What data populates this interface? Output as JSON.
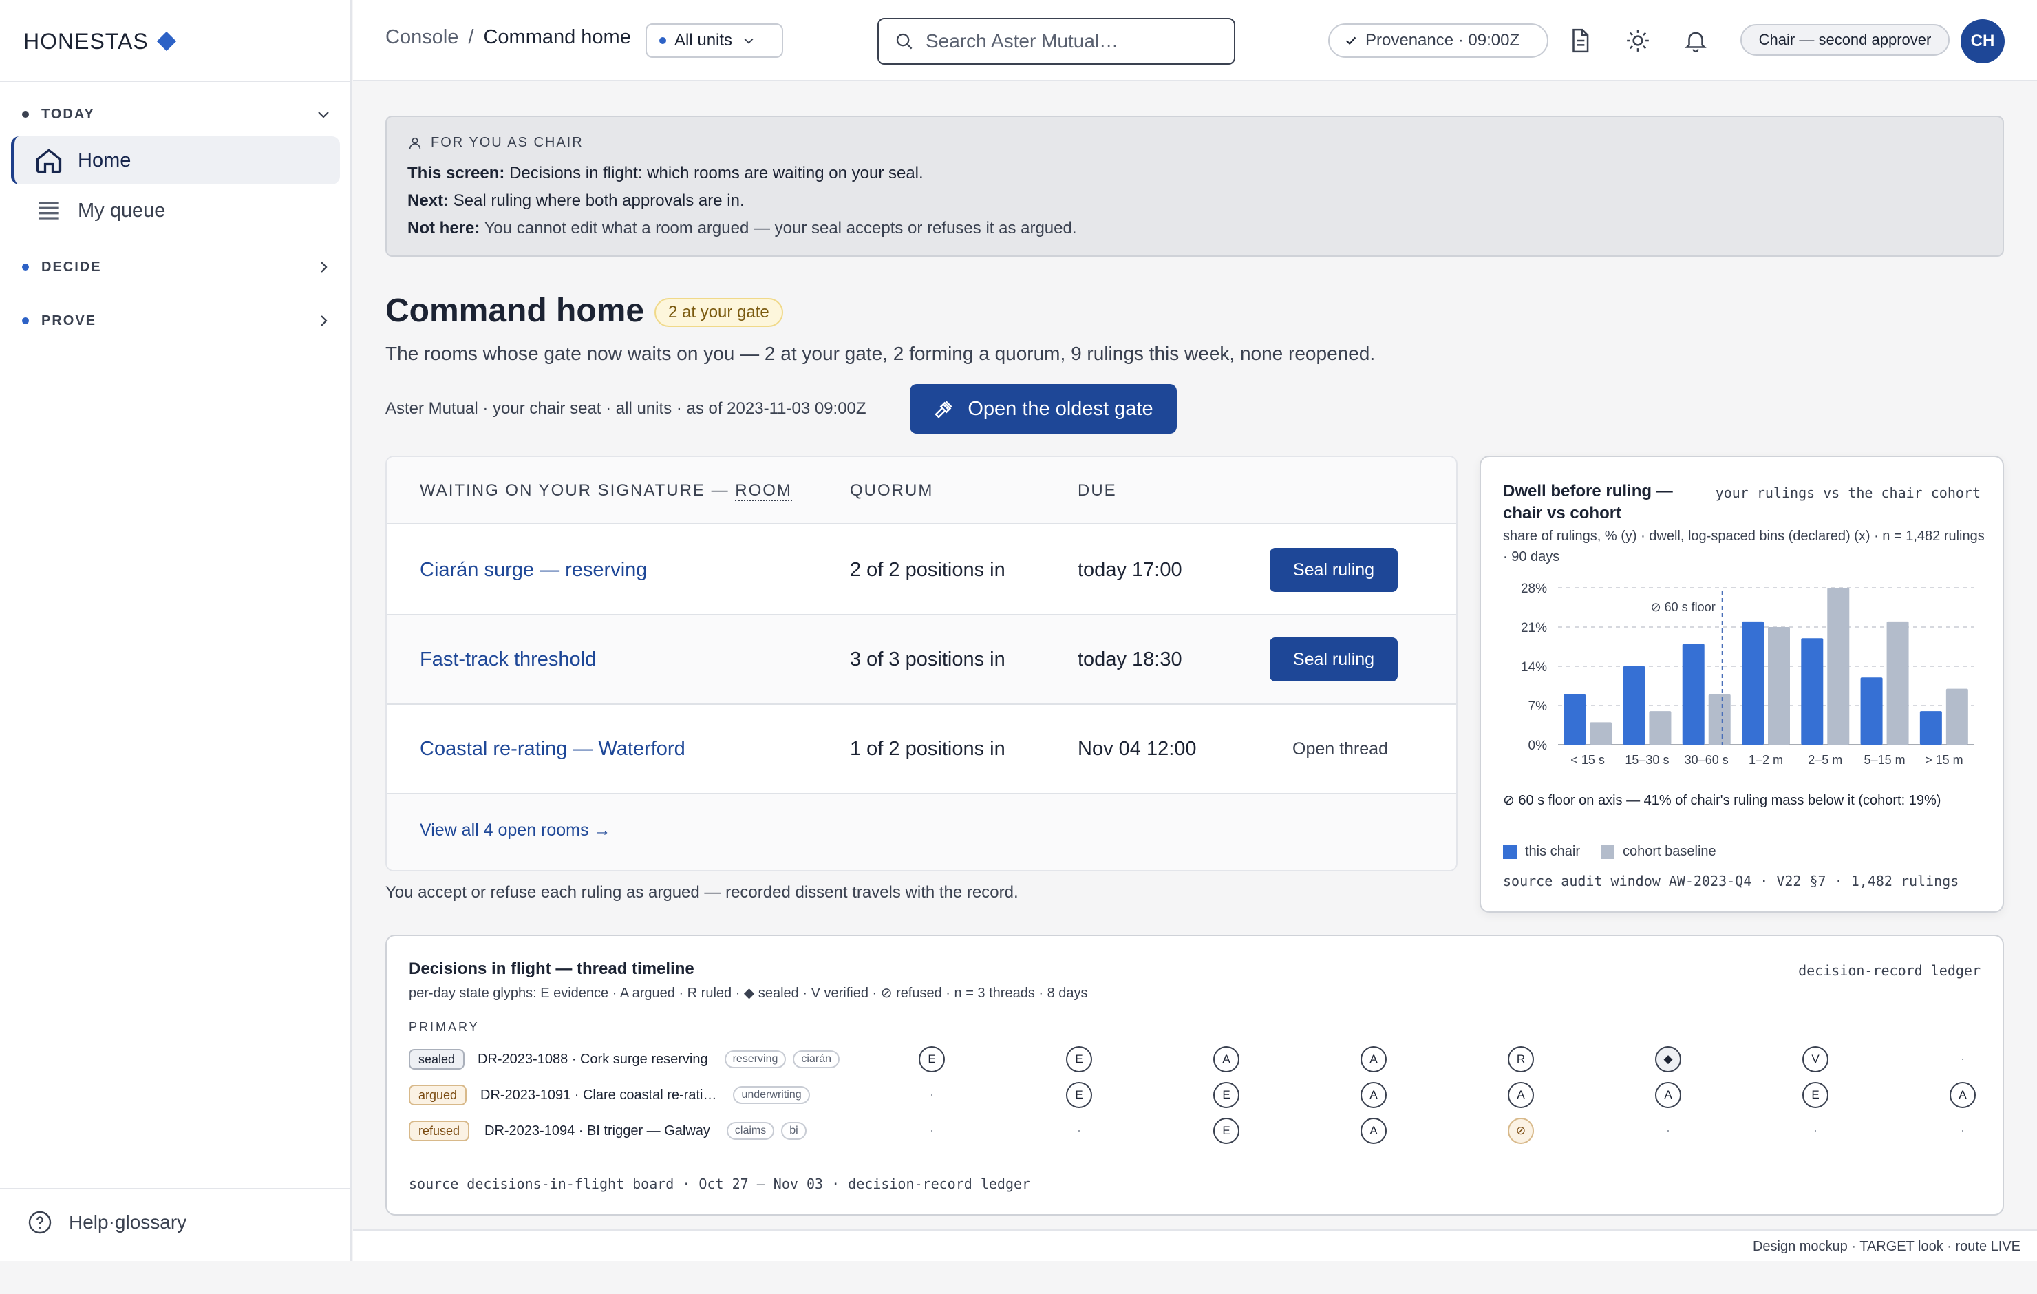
{
  "brand": {
    "name": "HONESTAS"
  },
  "sidebar": {
    "sections": [
      {
        "label": "TODAY"
      },
      {
        "label": "DECIDE"
      },
      {
        "label": "PROVE"
      }
    ],
    "items": [
      {
        "label": "Home",
        "icon": "home-icon"
      },
      {
        "label": "My queue",
        "icon": "list-icon"
      }
    ],
    "help": "Help·glossary"
  },
  "topbar": {
    "crumb_root": "Console",
    "crumb_sep": "/",
    "crumb_current": "Command home",
    "units": "All units",
    "search_placeholder": "Search Aster Mutual…",
    "provenance": "Provenance · 09:00Z",
    "role": "Chair — second approver",
    "avatar": "CH"
  },
  "chair_box": {
    "header": "FOR YOU AS CHAIR",
    "line1_label": "This screen:",
    "line1_text": "Decisions in flight: which rooms are waiting on your seal.",
    "line2_label": "Next:",
    "line2_text": "Seal ruling where both approvals are in.",
    "line3_label": "Not here:",
    "line3_text": "You cannot edit what a room argued — your seal accepts or refuses it as argued."
  },
  "page": {
    "title": "Command home",
    "badge": "2 at your gate",
    "subtitle": "The rooms whose gate now waits on you — 2 at your gate, 2 forming a quorum, 9 rulings this week, none reopened.",
    "meta": "Aster Mutual · your chair seat · all units · as of 2023-11-03 09:00Z",
    "primary_action": "Open the oldest gate"
  },
  "table": {
    "col_room_prefix": "WAITING ON YOUR SIGNATURE — ",
    "col_room_term": "ROOM",
    "col_quorum": "QUORUM",
    "col_due": "DUE",
    "rows": [
      {
        "room": "Ciarán surge — reserving",
        "quorum": "2 of 2 positions in",
        "due": "today 17:00",
        "action": "Seal ruling"
      },
      {
        "room": "Fast-track threshold",
        "quorum": "3 of 3 positions in",
        "due": "today 18:30",
        "action": "Seal ruling"
      },
      {
        "room": "Coastal re-rating — Waterford",
        "quorum": "1 of 2 positions in",
        "due": "Nov 04 12:00",
        "action": "Open thread"
      }
    ],
    "view_all": "View all 4 open rooms →",
    "footnote": "You accept or refuse each ruling as argued — recorded dissent travels with the record."
  },
  "chart_data": {
    "type": "bar",
    "title": "Dwell before ruling — chair vs cohort",
    "right_label": "your rulings vs the chair cohort",
    "subtitle": "share of rulings, % (y) · dwell, log-spaced bins (declared) (x) · n = 1,482 rulings · 90 days",
    "categories": [
      "< 15 s",
      "15–30 s",
      "30–60 s",
      "1–2 m",
      "2–5 m",
      "5–15 m",
      "> 15 m"
    ],
    "series": [
      {
        "name": "this chair",
        "color": "#3670d4",
        "values": [
          9,
          14,
          18,
          22,
          19,
          12,
          6
        ]
      },
      {
        "name": "cohort baseline",
        "color": "#b3bccb",
        "values": [
          4,
          6,
          9,
          21,
          28,
          22,
          10
        ]
      }
    ],
    "ylim": [
      0,
      28
    ],
    "yticks": [
      "0%",
      "7%",
      "14%",
      "21%",
      "28%"
    ],
    "annotation": "⊘ 60 s floor",
    "note": "⊘ 60 s floor on axis — 41% of chair's ruling mass below it (cohort: 19%)",
    "source": "source audit window AW-2023-Q4 · V22 §7 · 1,482 rulings",
    "grid": true,
    "legend": "bottom-left"
  },
  "timeline": {
    "title": "Decisions in flight — thread timeline",
    "right_label": "decision-record ledger",
    "subtitle": "per-day state glyphs: E evidence · A argued · R ruled · ◆ sealed · V verified · ⊘ refused · n = 3 threads · 8 days",
    "group": "PRIMARY",
    "rows": [
      {
        "state": "sealed",
        "title": "DR-2023-1088 · Cork surge reserving",
        "tags": [
          "reserving",
          "ciarán"
        ],
        "days": [
          "E",
          "E",
          "A",
          "A",
          "R",
          "◆",
          "V",
          "·"
        ]
      },
      {
        "state": "argued",
        "title": "DR-2023-1091 · Clare coastal re-rati…",
        "tags": [
          "underwriting"
        ],
        "days": [
          "·",
          "E",
          "E",
          "A",
          "A",
          "A",
          "E",
          "A"
        ]
      },
      {
        "state": "refused",
        "title": "DR-2023-1094 · BI trigger — Galway",
        "tags": [
          "claims",
          "bi"
        ],
        "days": [
          "·",
          "·",
          "E",
          "A",
          "⊘",
          "·",
          "·",
          "·"
        ]
      }
    ],
    "source": "source decisions-in-flight board · Oct 27 — Nov 03 · decision-record ledger"
  },
  "footer": {
    "text": "Design mockup · TARGET look · route LIVE"
  }
}
